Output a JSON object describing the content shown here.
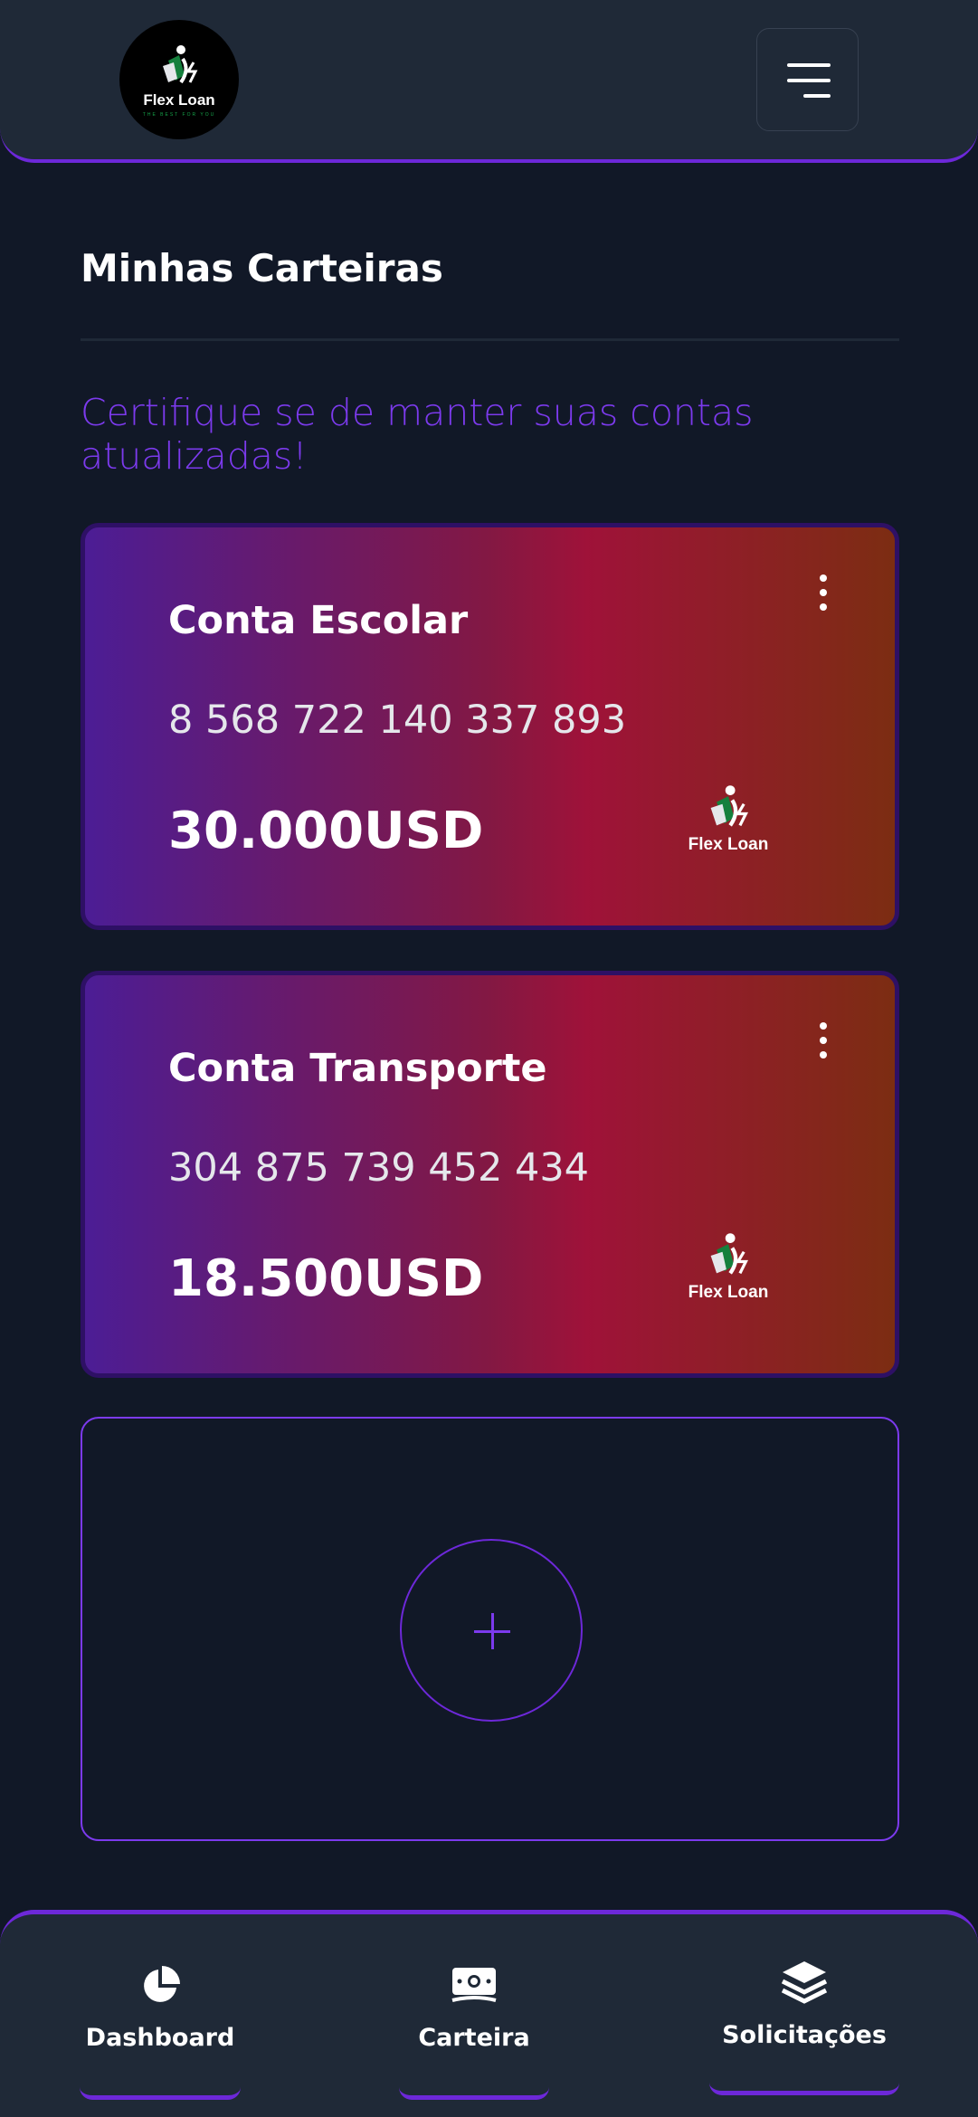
{
  "header": {
    "logo_text": "Flex Loan",
    "logo_tagline": "THE BEST FOR YOU",
    "menu_icon": "hamburger-menu-icon"
  },
  "page": {
    "title": "Minhas Carteiras",
    "subtitle": "Certifique se de manter suas contas atualizadas!"
  },
  "wallets": [
    {
      "name": "Conta Escolar",
      "number": "8 568 722 140 337 893",
      "amount": "30.000USD",
      "logo_text": "Flex Loan"
    },
    {
      "name": "Conta Transporte",
      "number": "304 875 739 452 434",
      "amount": "18.500USD",
      "logo_text": "Flex Loan"
    }
  ],
  "add_wallet": {
    "icon": "plus-icon"
  },
  "bottom_nav": {
    "items": [
      {
        "label": "Dashboard",
        "icon": "pie-chart-icon"
      },
      {
        "label": "Carteira",
        "icon": "money-icon"
      },
      {
        "label": "Solicitações",
        "icon": "layers-icon"
      }
    ]
  },
  "colors": {
    "background": "#111827",
    "surface": "#1f2937",
    "accent": "#6d28d9",
    "accent_text": "#7c3aed"
  }
}
